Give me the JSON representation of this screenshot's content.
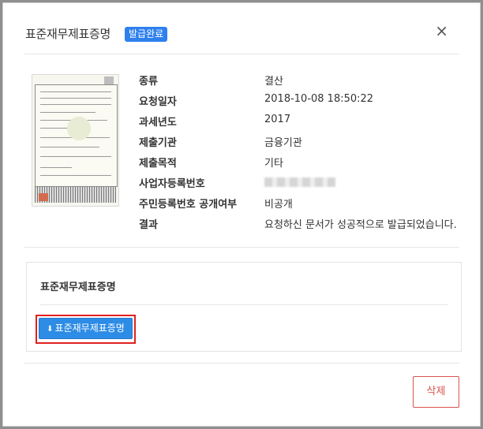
{
  "modal": {
    "title": "표준재무제표증명",
    "badge": "발급완료",
    "close_icon": "×"
  },
  "info": [
    {
      "label": "종류",
      "value": "결산"
    },
    {
      "label": "요청일자",
      "value": "2018-10-08 18:50:22"
    },
    {
      "label": "과세년도",
      "value": "2017"
    },
    {
      "label": "제출기관",
      "value": "금융기관"
    },
    {
      "label": "제출목적",
      "value": "기타"
    },
    {
      "label": "사업자등록번호",
      "value": ""
    },
    {
      "label": "주민등록번호 공개여부",
      "value": "비공개"
    },
    {
      "label": "결과",
      "value": "요청하신 문서가 성공적으로 발급되었습니다."
    }
  ],
  "panel": {
    "title": "표준재무제표증명",
    "download_label": "표준재무제표증명",
    "download_icon": "download-icon"
  },
  "footer": {
    "delete_label": "삭제"
  },
  "colors": {
    "accent": "#2d8ce6",
    "badge": "#2f80ed",
    "danger": "#d9534f",
    "highlight": "#e02020"
  }
}
